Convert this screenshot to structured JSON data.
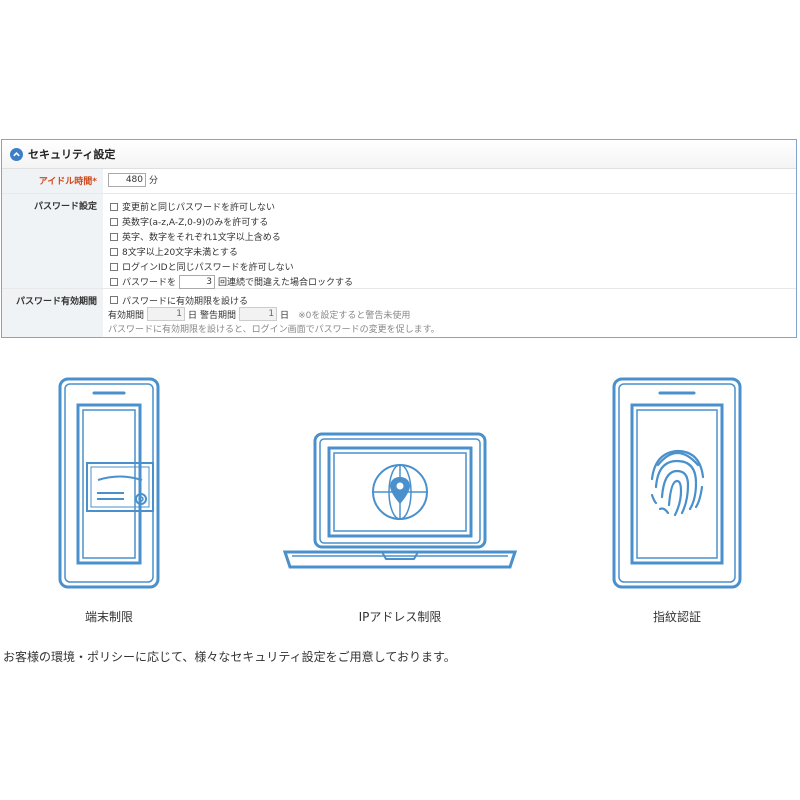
{
  "panel": {
    "title": "セキュリティ設定",
    "idle": {
      "label": "アイドル時間",
      "required_mark": "*",
      "value": "480",
      "unit": "分"
    },
    "password": {
      "label": "パスワード設定",
      "options": [
        "変更前と同じパスワードを許可しない",
        "英数字(a-z,A-Z,0-9)のみを許可する",
        "英字、数字をそれぞれ1文字以上含める",
        "8文字以上20文字未満とする",
        "ログインIDと同じパスワードを許可しない"
      ],
      "lock": {
        "prefix": "パスワードを",
        "value": "3",
        "suffix": "回連続で間違えた場合ロックする"
      }
    },
    "expiry": {
      "label": "パスワード有効期間",
      "checkbox_label": "パスワードに有効期限を設ける",
      "period_label": "有効期間",
      "period_value": "1",
      "period_unit": "日",
      "warning_label": "警告期間",
      "warning_value": "1",
      "warning_unit": "日",
      "warning_note": "※0を設定すると警告未使用",
      "help_text": "パスワードに有効期限を設けると、ログイン画面でパスワードの変更を促します。"
    }
  },
  "features": [
    {
      "caption": "端末制限",
      "icon": "phone-certificate-icon"
    },
    {
      "caption": "IPアドレス制限",
      "icon": "laptop-globe-pin-icon"
    },
    {
      "caption": "指紋認証",
      "icon": "phone-fingerprint-icon"
    }
  ],
  "description": "お客様の環境・ポリシーに応じて、様々なセキュリティ設定をご用意しております。",
  "colors": {
    "accent": "#3c7fc8",
    "illustration": "#4a90cc",
    "required": "#d0491c",
    "panel_border": "#7fa6c9"
  }
}
